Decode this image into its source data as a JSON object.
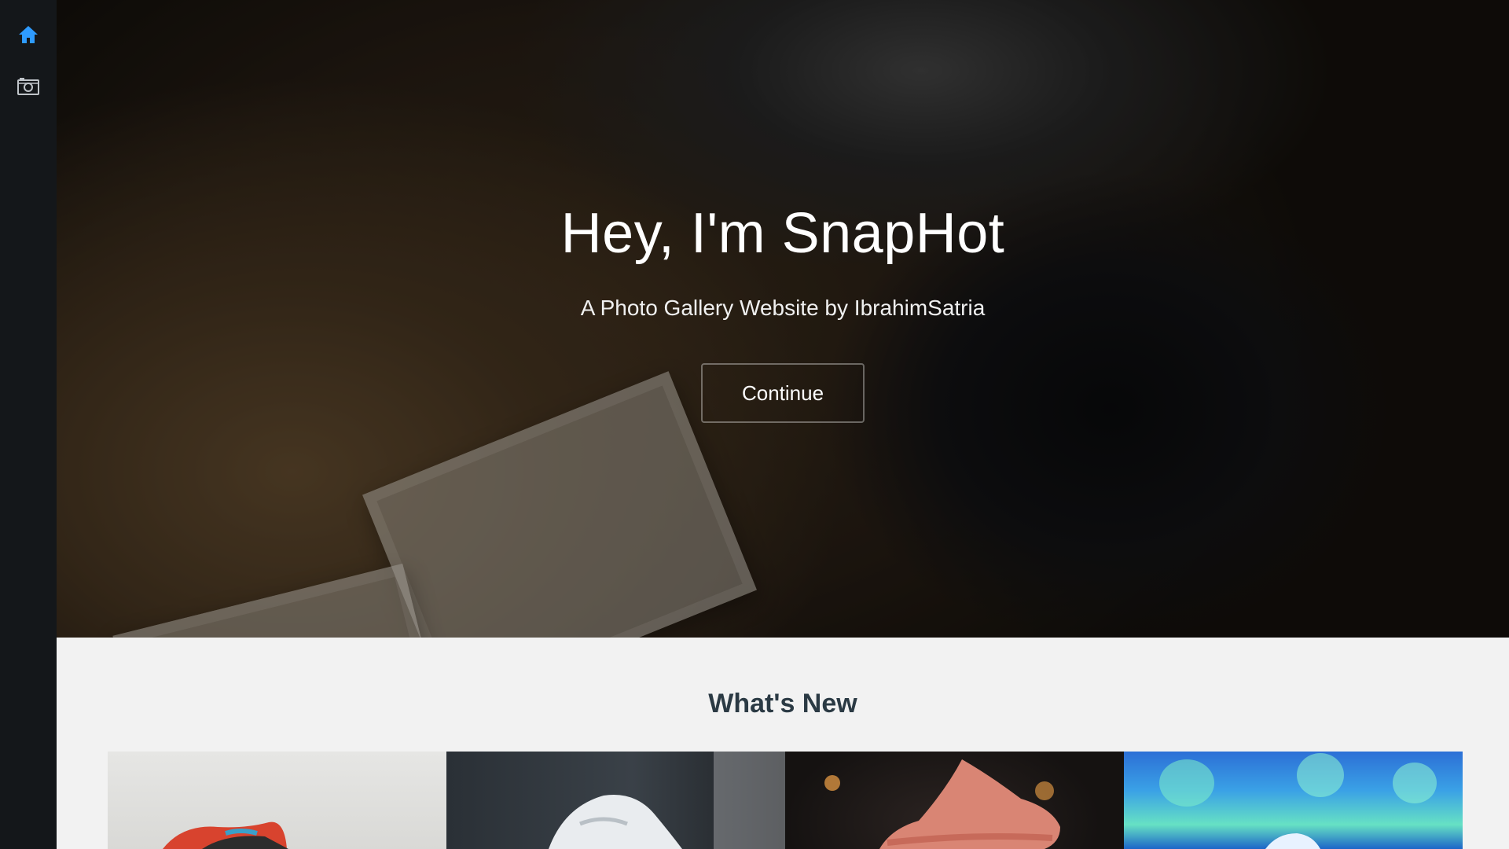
{
  "sidebar": {
    "items": [
      {
        "icon": "home-icon",
        "active": true
      },
      {
        "icon": "camera-icon",
        "active": false
      }
    ],
    "accent": "#2e9bff"
  },
  "hero": {
    "title": "Hey, I'm SnapHot",
    "subtitle": "A Photo Gallery Website by IbrahimSatria",
    "cta_label": "Continue"
  },
  "section": {
    "title": "What's New"
  },
  "gallery": {
    "tiles": [
      {
        "subject": "colorful sneaker"
      },
      {
        "subject": "white sneaker"
      },
      {
        "subject": "pink sneaker"
      },
      {
        "subject": "blue sneaker"
      }
    ]
  }
}
